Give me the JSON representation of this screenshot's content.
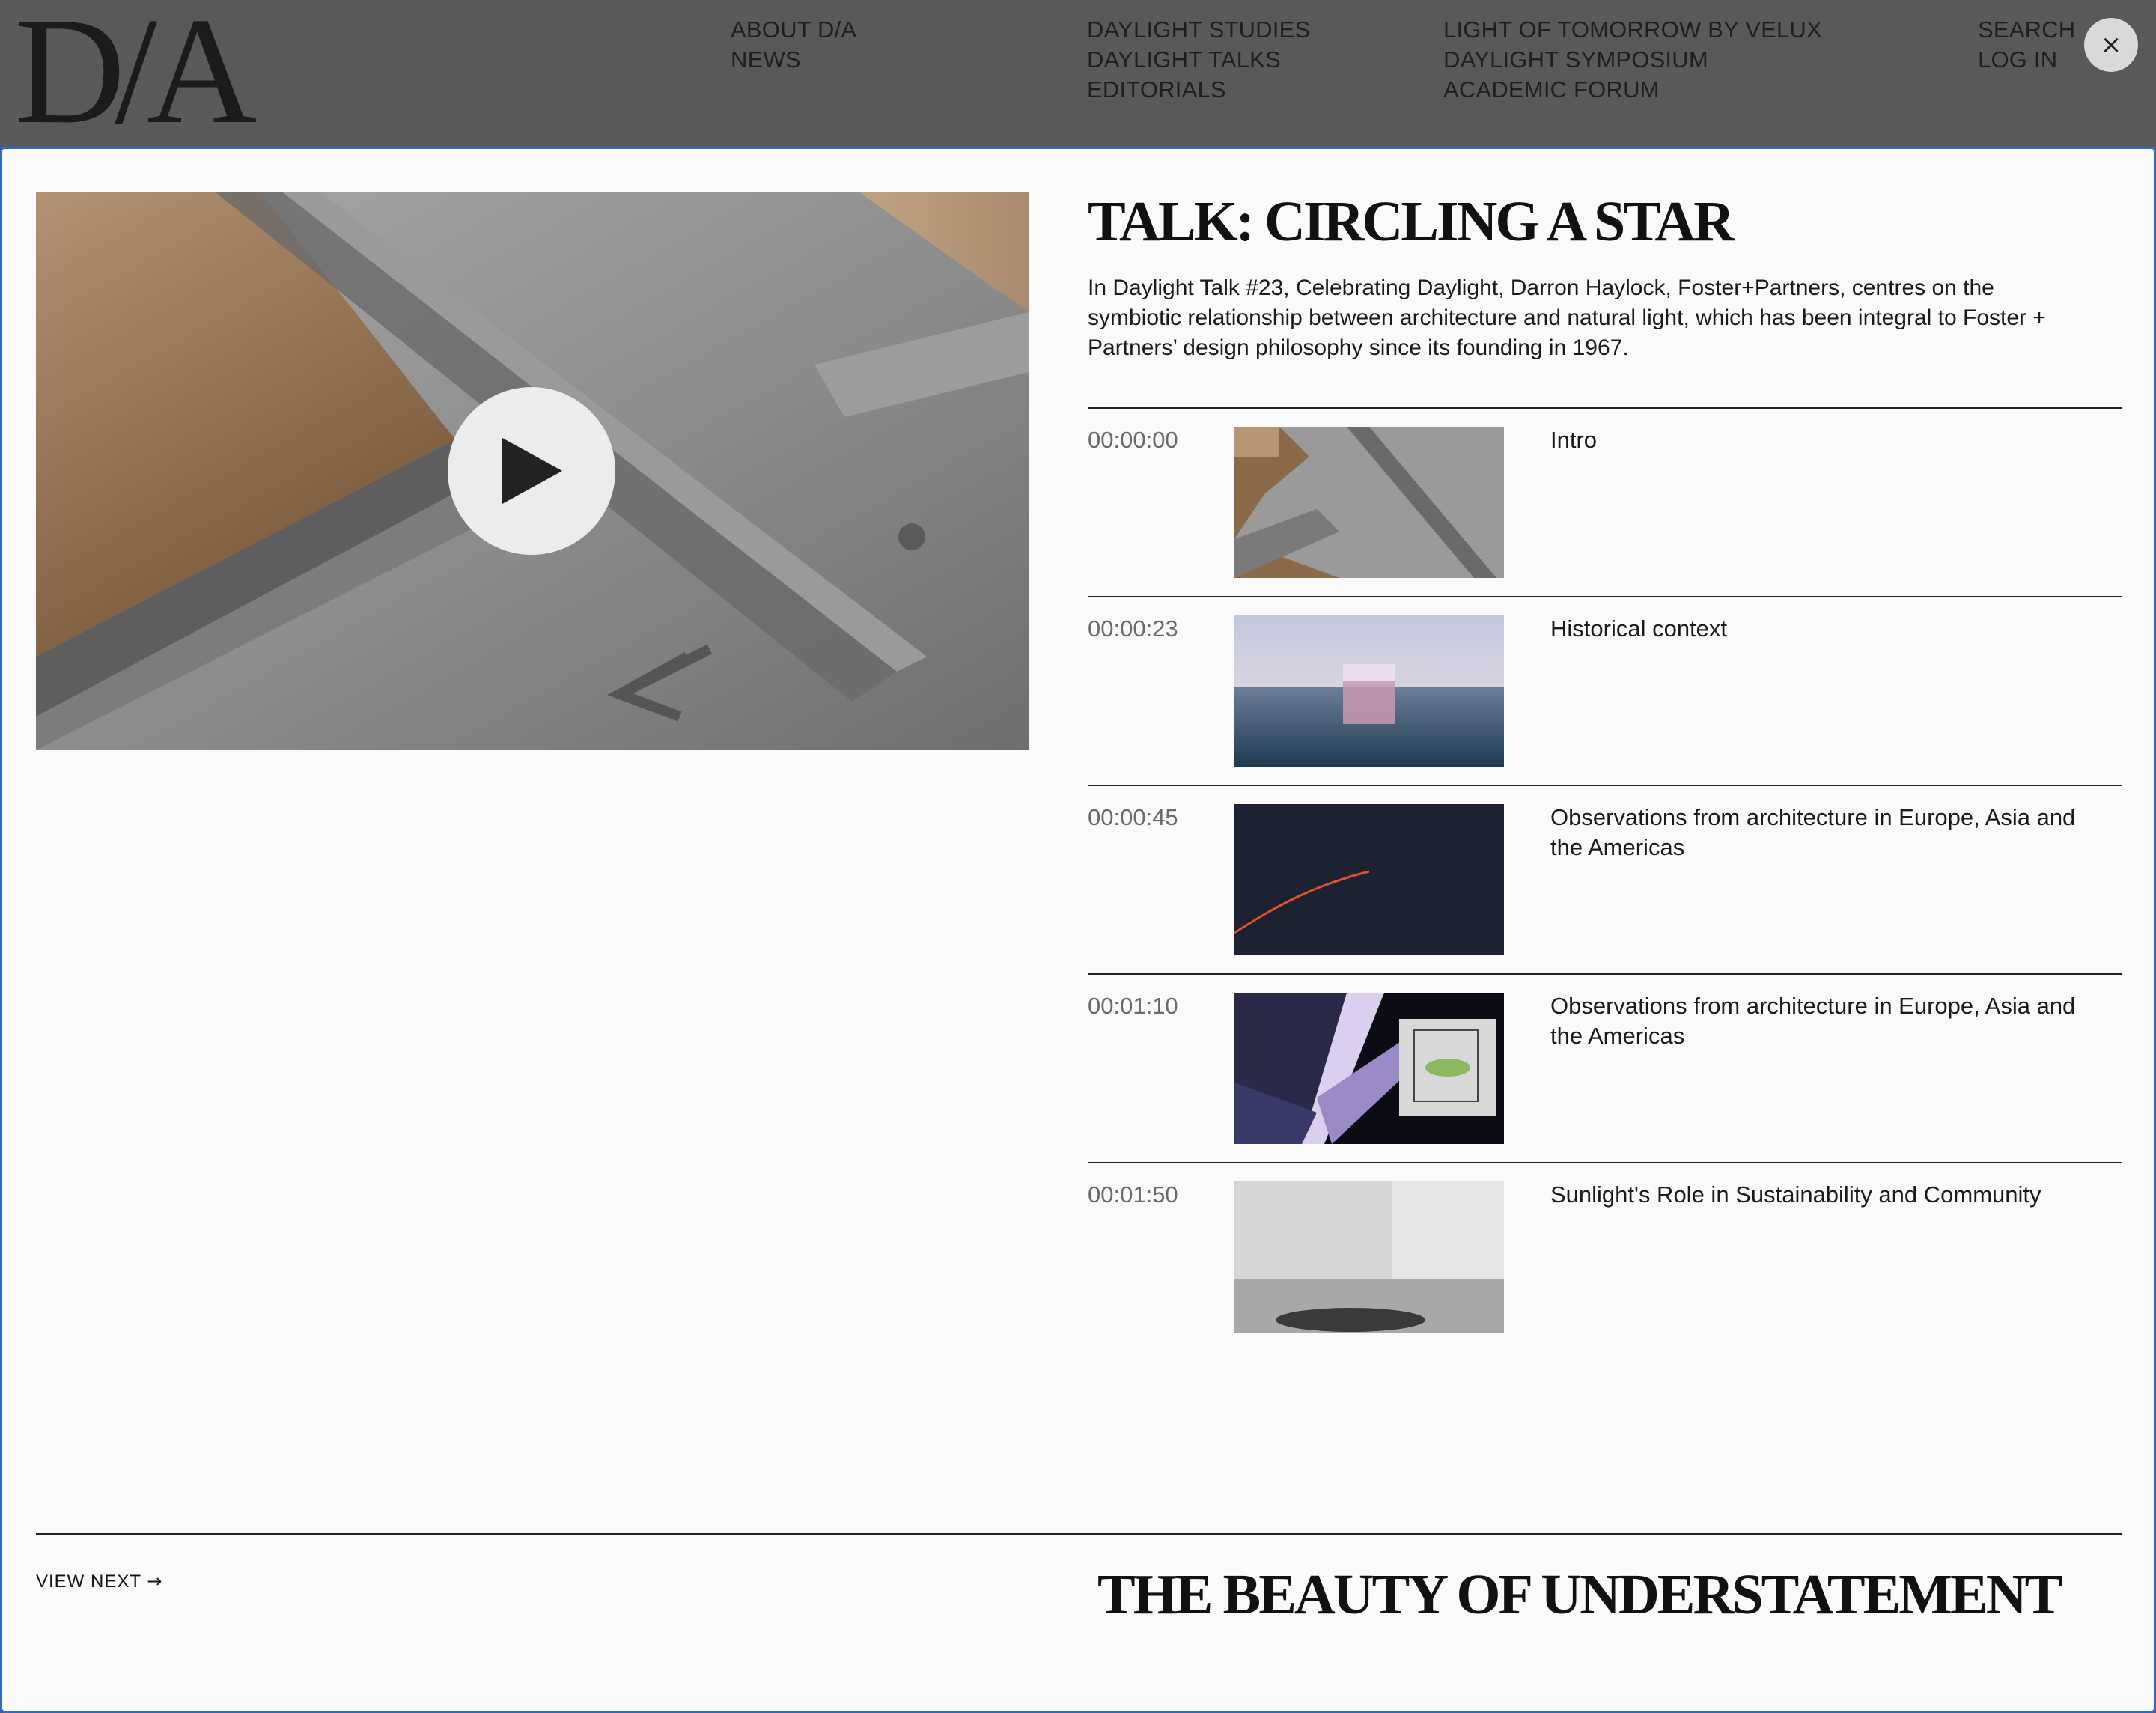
{
  "header": {
    "logo": "D/A",
    "nav": {
      "col1": [
        "ABOUT D/A",
        "NEWS"
      ],
      "col2": [
        "DAYLIGHT STUDIES",
        "DAYLIGHT TALKS",
        "EDITORIALS"
      ],
      "col3": [
        "LIGHT OF TOMORROW BY VELUX",
        "DAYLIGHT SYMPOSIUM",
        "ACADEMIC FORUM"
      ],
      "col4": [
        "SEARCH",
        "LOG IN"
      ]
    },
    "close_icon": "close-icon",
    "close_symbol": "×"
  },
  "talk": {
    "title": "TALK: CIRCLING A STAR",
    "description": "In Daylight Talk #23, Celebrating Daylight, Darron Haylock, Foster+Partners, centres on the symbiotic relationship between architecture and natural light, which has been integral to Foster + Partners’ design philosophy since its founding in 1967.",
    "play_icon": "play-icon"
  },
  "chapters": [
    {
      "time": "00:00:00",
      "title": "Intro"
    },
    {
      "time": "00:00:23",
      "title": "Historical context"
    },
    {
      "time": "00:00:45",
      "title": "Observations from architecture in Europe, Asia and the Americas"
    },
    {
      "time": "00:01:10",
      "title": "Observations from architecture in Europe, Asia and the Americas"
    },
    {
      "time": "00:01:50",
      "title": "Sunlight's Role in Sustainability and Community"
    }
  ],
  "footer": {
    "view_next_label": "VIEW NEXT",
    "view_next_arrow": "→",
    "next_title": "THE BEAUTY OF UNDERSTATEMENT"
  },
  "colors": {
    "header_bg": "#595959",
    "panel_bg": "#fafafa",
    "panel_border": "#2d6cc0"
  }
}
